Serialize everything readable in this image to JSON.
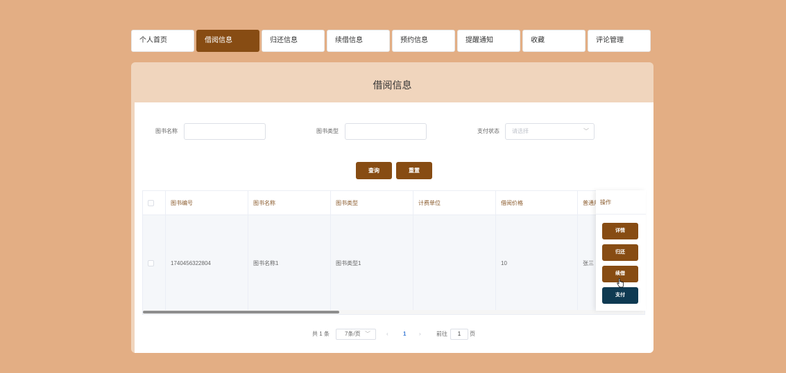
{
  "tabs": [
    {
      "label": "个人首页"
    },
    {
      "label": "借阅信息"
    },
    {
      "label": "归还信息"
    },
    {
      "label": "续借信息"
    },
    {
      "label": "预约信息"
    },
    {
      "label": "提醒通知"
    },
    {
      "label": "收藏"
    },
    {
      "label": "评论管理"
    }
  ],
  "active_tab": "借阅信息",
  "panel": {
    "title": "借阅信息"
  },
  "filters": {
    "book_name_label": "图书名称",
    "book_name_value": "",
    "book_type_label": "图书类型",
    "book_type_value": "",
    "pay_status_label": "支付状态",
    "pay_status_placeholder": "请选择"
  },
  "buttons": {
    "query": "查询",
    "reset": "重置"
  },
  "table": {
    "columns": [
      "图书编号",
      "图书名称",
      "图书类型",
      "计费单位",
      "借阅价格",
      "普通用"
    ],
    "ops_header": "操作",
    "rows": [
      {
        "book_no": "1740456322804",
        "book_name": "图书名称1",
        "book_type": "图书类型1",
        "billing_unit": "",
        "price": "10",
        "user": "张三"
      }
    ],
    "row_actions": [
      "详情",
      "归还",
      "续借",
      "支付"
    ]
  },
  "pagination": {
    "total": "共 1 条",
    "page_size": "7条/页",
    "current_page": "1",
    "goto_label": "前往",
    "goto_value": "1",
    "page_suffix": "页"
  },
  "colors": {
    "accent": "#874c13",
    "pay_button": "#0f3a52",
    "background": "#e3ae84",
    "panel_header": "#f0d5bd"
  }
}
